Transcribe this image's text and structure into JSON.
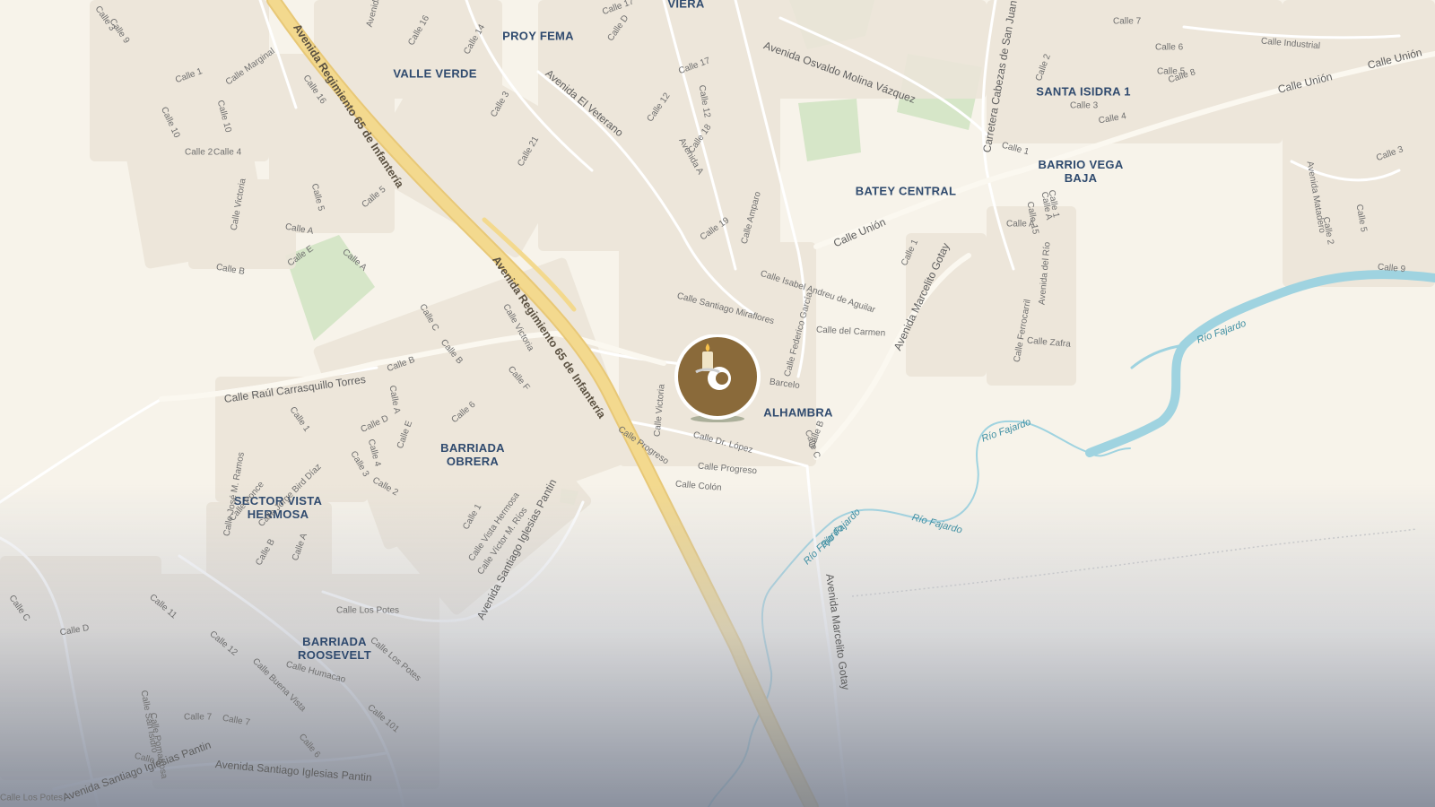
{
  "map": {
    "colors": {
      "background": "#f7f3ea",
      "highway": "#f0d48a",
      "road": "#ffffff",
      "block": "#e9e3d6",
      "park": "#d6e6c8",
      "river": "#9fd3e0",
      "neighborhood_label": "#2f4a6e",
      "marker_fill": "#8a6a3a",
      "marker_ring": "#ffffff"
    },
    "neighborhoods": [
      "VIERA",
      "PROY FEMA",
      "VALLE VERDE",
      "SANTA ISIDRA 1",
      "BARRIO VEGA\nBAJA",
      "BATEY CENTRAL",
      "ALHAMBRA",
      "BARRIADA\nOBRERA",
      "SECTOR VISTA\nHERMOSA",
      "BARRIADA\nROOSEVELT"
    ],
    "highways": [
      "Avenida Regimiento 65 de Infantería",
      "Avenida Regimiento 65 de Infantería"
    ],
    "arterials": [
      "Avenida Marcelito Gotay",
      "Avenida Marcelito Gotay",
      "Calle Unión",
      "Calle Unión",
      "Calle Unión",
      "Avenida Santiago Iglesias Pantin",
      "Avenida Santiago Iglesias Pantin",
      "Calle Raúl Carrasquillo Torres",
      "Avenida El Veterano",
      "Carretera Cabezas de San Juan",
      "Avenida Osvaldo Molina Vázquez",
      "Avenida Santiago Iglesias Pantin"
    ],
    "streets": [
      "Calle Industrial",
      "Calle 8",
      "Calle 7",
      "Calle 6",
      "Calle 5",
      "Calle 3",
      "Calle 4",
      "Calle 2",
      "Calle 1",
      "Calle 17",
      "Calle 12",
      "Calle 18",
      "Avenida A",
      "Calle 19",
      "Calle Amparo",
      "Calle Isabel Andreu de Aguilar",
      "Calle Santiago Miraflores",
      "Calle del Carmen",
      "Calle Federico García",
      "Barcelo",
      "Calle Victoria",
      "Calle Dr. López",
      "Calle Progreso",
      "Calle Progreso",
      "Calle Colón",
      "Calle C",
      "Calle B",
      "Calle 1",
      "Calle Ferrocarril",
      "Calle Zafra",
      "Avenida del Río",
      "Avenida Matadero",
      "Calle 9",
      "Calle 2",
      "Calle 5",
      "Calle 3",
      "Calle 1",
      "Calle A",
      "Calle D",
      "Calle 14",
      "Calle 16",
      "Avenida B",
      "Calle 3",
      "Calle 21",
      "Calle 12",
      "Calle 17",
      "Calle 16",
      "Calle Marginal",
      "Calle 1",
      "Calle 3",
      "Calle 9",
      "Calle 10",
      "Calle 10",
      "Calle 2",
      "Calle 4",
      "Calle 5",
      "Calle 5",
      "Calle Victoria",
      "Calle A",
      "Calle E",
      "Calle B",
      "Calle A",
      "Calle C",
      "Calle Victoria",
      "Calle B",
      "Calle F",
      "Calle B",
      "Calle A",
      "Calle D",
      "Calle 6",
      "Calle 4",
      "Calle E",
      "Calle 3",
      "Calle 2",
      "Calle 1",
      "Calle 1",
      "Calle Vista Hermosa",
      "Calle Víctor M. Ríos",
      "Calle Jorge Bird Díaz",
      "Calle José M. Ramos",
      "Calle B",
      "Calle A",
      "Calle C",
      "Calle D",
      "Calle 11",
      "Calle 12",
      "Calle Los Potes",
      "Calle Los Potes",
      "Calle Buena Vista",
      "Calle Humacao",
      "Calle San Isidro",
      "Calle Pomarrosa",
      "Calle 7",
      "Calle 7",
      "Calle 6",
      "Calle 6",
      "Calle 101",
      "Calle Los Potes",
      "Calle Ponce",
      "Calle 15",
      "Calle A",
      "Calle D",
      "Calle 12"
    ],
    "rivers": [
      "Río Fajardo",
      "Río Fajardo",
      "Río Fajardo",
      "Río Fajardo",
      "Río Fajardo"
    ],
    "marker": {
      "icon": "candle-icon"
    }
  }
}
